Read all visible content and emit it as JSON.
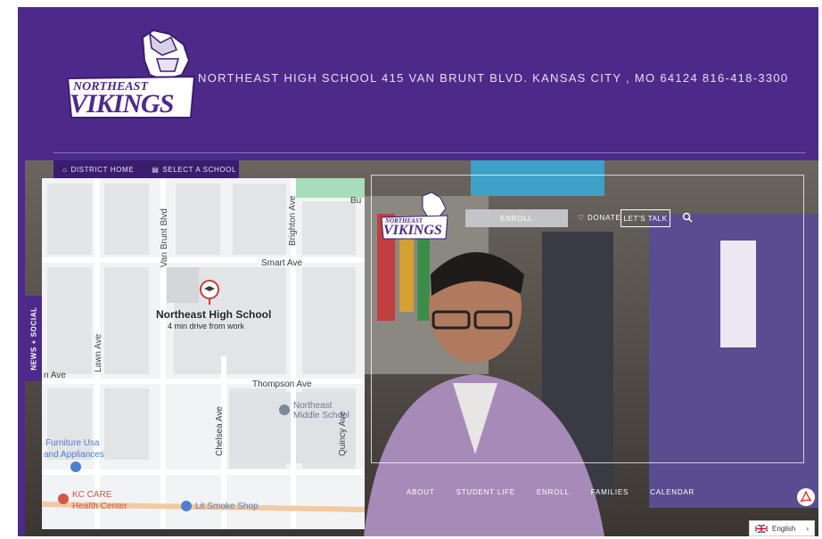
{
  "header": {
    "logo_top_text": "NORTHEAST",
    "logo_main_text": "VIKINGS",
    "contact_line": "NORTHEAST HIGH SCHOOL  415 VAN BRUNT BLVD.  KANSAS CITY , MO 64124  816-418-3300"
  },
  "quicklinks": [
    {
      "icon": "building-icon",
      "label": "DISTRICT HOME"
    },
    {
      "icon": "school-list-icon",
      "label": "SELECT A SCHOOL"
    }
  ],
  "hero": {
    "logo_top_text": "NORTHEAST",
    "logo_main_text": "VIKINGS",
    "enroll_label": "ENROLL",
    "donate_label": "DONATE",
    "talk_label": "LET'S TALK",
    "search_icon": "search-icon",
    "nav": [
      "ABOUT",
      "STUDENT LIFE",
      "ENROLL",
      "FAMILIES",
      "CALENDAR"
    ],
    "pdf_icon": "pdf-icon"
  },
  "news_tab": "NEWS + SOCIAL",
  "map": {
    "place_name": "Northeast High School",
    "place_sub": "4 min drive from work",
    "streets": {
      "van_brunt": "Van Brunt Blvd",
      "brighton": "Brighton Ave",
      "smart": "Smart Ave",
      "lawn": "Lawn Ave",
      "thompson": "Thompson Ave",
      "chelsea": "Chelsea Ave",
      "quincy": "Quincy Ave",
      "n_ave": "n Ave",
      "bu": "Bu"
    },
    "pois": {
      "middle_school": "Northeast Middle School",
      "furniture_line1": "Furniture Usa",
      "furniture_line2": "and Appliances",
      "kc_care_line1": "KC CARE",
      "kc_care_line2": "Health Center",
      "smoke_shop": "Lit Smoke Shop"
    }
  },
  "language": {
    "label": "English",
    "flag_icon": "uk-flag-icon",
    "arrow_icon": "chevron-right-icon"
  },
  "colors": {
    "brand_purple": "#4d2a8a",
    "dark_purple": "#3a1d6e"
  }
}
